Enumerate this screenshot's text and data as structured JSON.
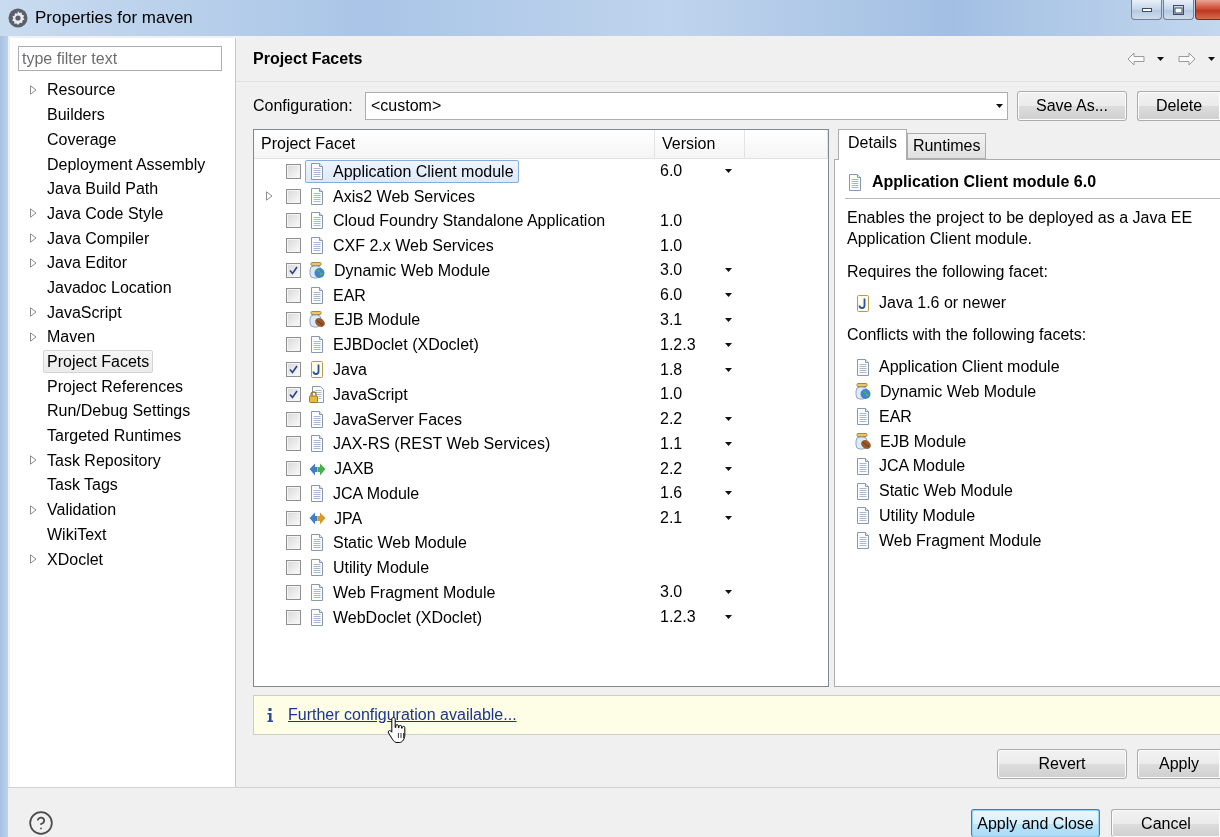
{
  "window": {
    "title": "Properties for maven"
  },
  "sidebar": {
    "filter": {
      "placeholder": "type filter text"
    },
    "items": [
      {
        "label": "Resource",
        "expandable": true,
        "selected": false
      },
      {
        "label": "Builders",
        "expandable": false,
        "selected": false
      },
      {
        "label": "Coverage",
        "expandable": false,
        "selected": false
      },
      {
        "label": "Deployment Assembly",
        "expandable": false,
        "selected": false
      },
      {
        "label": "Java Build Path",
        "expandable": false,
        "selected": false
      },
      {
        "label": "Java Code Style",
        "expandable": true,
        "selected": false
      },
      {
        "label": "Java Compiler",
        "expandable": true,
        "selected": false
      },
      {
        "label": "Java Editor",
        "expandable": true,
        "selected": false
      },
      {
        "label": "Javadoc Location",
        "expandable": false,
        "selected": false
      },
      {
        "label": "JavaScript",
        "expandable": true,
        "selected": false
      },
      {
        "label": "Maven",
        "expandable": true,
        "selected": false
      },
      {
        "label": "Project Facets",
        "expandable": false,
        "selected": true
      },
      {
        "label": "Project References",
        "expandable": false,
        "selected": false
      },
      {
        "label": "Run/Debug Settings",
        "expandable": false,
        "selected": false
      },
      {
        "label": "Targeted Runtimes",
        "expandable": false,
        "selected": false
      },
      {
        "label": "Task Repository",
        "expandable": true,
        "selected": false
      },
      {
        "label": "Task Tags",
        "expandable": false,
        "selected": false
      },
      {
        "label": "Validation",
        "expandable": true,
        "selected": false
      },
      {
        "label": "WikiText",
        "expandable": false,
        "selected": false
      },
      {
        "label": "XDoclet",
        "expandable": true,
        "selected": false
      }
    ]
  },
  "page": {
    "title": "Project Facets",
    "configuration": {
      "label": "Configuration:",
      "value": "<custom>"
    },
    "buttons": [
      "Save As...",
      "Delete"
    ]
  },
  "facets_table": {
    "columns": [
      "Project Facet",
      "Version"
    ],
    "rows": [
      {
        "name": "Application Client module",
        "kind": "document",
        "version": "6.0",
        "dropdown": true,
        "checked": false,
        "selected": true,
        "expandable": false
      },
      {
        "name": "Axis2 Web Services",
        "kind": "document",
        "dropdown": false,
        "checked": false,
        "selected": false,
        "expandable": true
      },
      {
        "name": "Cloud Foundry Standalone Application",
        "kind": "document",
        "version": "1.0",
        "dropdown": false,
        "checked": false,
        "selected": false,
        "expandable": false
      },
      {
        "name": "CXF 2.x Web Services",
        "kind": "document",
        "version": "1.0",
        "dropdown": false,
        "checked": false,
        "selected": false,
        "expandable": false
      },
      {
        "name": "Dynamic Web Module",
        "kind": "web",
        "version": "3.0",
        "dropdown": true,
        "checked": true,
        "selected": false,
        "expandable": false
      },
      {
        "name": "EAR",
        "kind": "document",
        "version": "6.0",
        "dropdown": true,
        "checked": false,
        "selected": false,
        "expandable": false
      },
      {
        "name": "EJB Module",
        "kind": "ejb",
        "version": "3.1",
        "dropdown": true,
        "checked": false,
        "selected": false,
        "expandable": false
      },
      {
        "name": "EJBDoclet (XDoclet)",
        "kind": "document",
        "version": "1.2.3",
        "dropdown": true,
        "checked": false,
        "selected": false,
        "expandable": false
      },
      {
        "name": "Java",
        "kind": "java",
        "version": "1.8",
        "dropdown": true,
        "checked": true,
        "selected": false,
        "expandable": false
      },
      {
        "name": "JavaScript",
        "kind": "locked-document",
        "version": "1.0",
        "dropdown": false,
        "checked": true,
        "selected": false,
        "expandable": false
      },
      {
        "name": "JavaServer Faces",
        "kind": "document",
        "version": "2.2",
        "dropdown": true,
        "checked": false,
        "selected": false,
        "expandable": false
      },
      {
        "name": "JAX-RS (REST Web Services)",
        "kind": "document",
        "version": "1.1",
        "dropdown": true,
        "checked": false,
        "selected": false,
        "expandable": false
      },
      {
        "name": "JAXB",
        "kind": "green-arrows",
        "version": "2.2",
        "dropdown": true,
        "checked": false,
        "selected": false,
        "expandable": false
      },
      {
        "name": "JCA Module",
        "kind": "document",
        "version": "1.6",
        "dropdown": true,
        "checked": false,
        "selected": false,
        "expandable": false
      },
      {
        "name": "JPA",
        "kind": "orange-arrows",
        "version": "2.1",
        "dropdown": true,
        "checked": false,
        "selected": false,
        "expandable": false
      },
      {
        "name": "Static Web Module",
        "kind": "document",
        "dropdown": false,
        "checked": false,
        "selected": false,
        "expandable": false
      },
      {
        "name": "Utility Module",
        "kind": "document",
        "dropdown": false,
        "checked": false,
        "selected": false,
        "expandable": false
      },
      {
        "name": "Web Fragment Module",
        "kind": "document",
        "version": "3.0",
        "dropdown": true,
        "checked": false,
        "selected": false,
        "expandable": false
      },
      {
        "name": "WebDoclet (XDoclet)",
        "kind": "document",
        "version": "1.2.3",
        "dropdown": true,
        "checked": false,
        "selected": false,
        "expandable": false
      }
    ]
  },
  "details": {
    "tabs": [
      {
        "label": "Details",
        "selected": true
      },
      {
        "label": "Runtimes",
        "selected": false
      }
    ],
    "title": "Application Client module 6.0",
    "description": "Enables the project to be deployed as a Java EE Application Client module.",
    "requires_label": "Requires the following facet:",
    "requires": [
      {
        "name": "Java 1.6 or newer",
        "kind": "java"
      }
    ],
    "conflicts_label": "Conflicts with the following facets:",
    "conflicts": [
      {
        "name": "Application Client module",
        "kind": "document"
      },
      {
        "name": "Dynamic Web Module",
        "kind": "web"
      },
      {
        "name": "EAR",
        "kind": "document"
      },
      {
        "name": "EJB Module",
        "kind": "ejb"
      },
      {
        "name": "JCA Module",
        "kind": "document"
      },
      {
        "name": "Static Web Module",
        "kind": "document"
      },
      {
        "name": "Utility Module",
        "kind": "document"
      },
      {
        "name": "Web Fragment Module",
        "kind": "document"
      }
    ]
  },
  "info_bar": {
    "link": "Further configuration available..."
  },
  "page_buttons": [
    "Revert",
    "Apply"
  ],
  "dialog_buttons": [
    {
      "label": "Apply and Close",
      "focused": true
    },
    {
      "label": "Cancel",
      "focused": false
    }
  ]
}
